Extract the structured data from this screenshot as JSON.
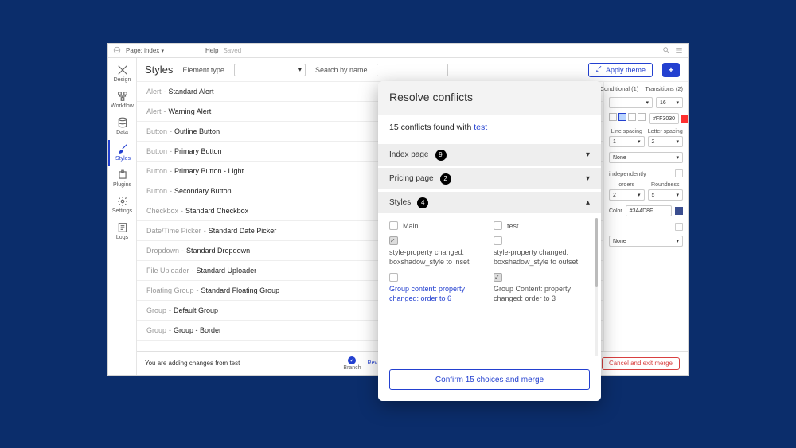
{
  "topbar": {
    "page_label_prefix": "Page:",
    "page_name": "index",
    "help": "Help",
    "saved": "Saved"
  },
  "rail": {
    "items": [
      {
        "id": "design",
        "label": "Design"
      },
      {
        "id": "workflow",
        "label": "Workflow"
      },
      {
        "id": "data",
        "label": "Data"
      },
      {
        "id": "styles",
        "label": "Styles"
      },
      {
        "id": "plugins",
        "label": "Plugins"
      },
      {
        "id": "settings",
        "label": "Settings"
      },
      {
        "id": "logs",
        "label": "Logs"
      }
    ],
    "active": "styles"
  },
  "toolbar": {
    "title": "Styles",
    "element_type_label": "Element type",
    "search_label": "Search by name",
    "apply_label": "Apply theme",
    "plus_label": "+"
  },
  "styles": [
    {
      "cat": "Alert",
      "name": "Standard Alert"
    },
    {
      "cat": "Alert",
      "name": "Warning Alert"
    },
    {
      "cat": "Button",
      "name": "Outline Button"
    },
    {
      "cat": "Button",
      "name": "Primary Button"
    },
    {
      "cat": "Button",
      "name": "Primary Button - Light"
    },
    {
      "cat": "Button",
      "name": "Secondary Button"
    },
    {
      "cat": "Checkbox",
      "name": "Standard Checkbox"
    },
    {
      "cat": "Date/Time Picker",
      "name": "Standard Date Picker"
    },
    {
      "cat": "Dropdown",
      "name": "Standard Dropdown"
    },
    {
      "cat": "File Uploader",
      "name": "Standard Uploader"
    },
    {
      "cat": "Floating Group",
      "name": "Standard Floating Group"
    },
    {
      "cat": "Group",
      "name": "Default Group"
    },
    {
      "cat": "Group",
      "name": "Group - Border"
    }
  ],
  "props": {
    "tabs": {
      "conditional": "Conditional (1)",
      "transitions": "Transitions (2)"
    },
    "font_size": "16",
    "line_spacing_label": "Line spacing",
    "letter_spacing_label": "Letter spacing",
    "line_spacing": "1",
    "letter_spacing": "2",
    "color1": "#FF3030",
    "shadow_label": "None",
    "independent_label": "independently",
    "borders_label": "orders",
    "roundness_label": "Roundness",
    "borders_value": "2",
    "roundness_value": "5",
    "color2_label": "Color",
    "color2": "#3A4D8F",
    "background_label": "None"
  },
  "bottombar": {
    "msg": "You are adding changes from test",
    "branch": "Branch",
    "rev": "Rev",
    "cancel": "Cancel and exit merge"
  },
  "modal": {
    "title": "Resolve conflicts",
    "sub_prefix": "15 conflicts found with ",
    "sub_link": "test",
    "sections": [
      {
        "label": "Index page",
        "count": "9",
        "open": false
      },
      {
        "label": "Pricing page",
        "count": "2",
        "open": false
      },
      {
        "label": "Styles",
        "count": "4",
        "open": true
      }
    ],
    "cols": {
      "left": "Main",
      "right": "test"
    },
    "rows": [
      {
        "left_checked": true,
        "right_checked": false,
        "left_text": "style-property changed: boxshadow_style to inset",
        "right_text": "style-property changed: boxshadow_style to outset",
        "left_selected": false
      },
      {
        "left_checked": false,
        "right_checked": true,
        "left_text": "Group content: property changed: order to 6",
        "right_text": "Group Content: property changed: order to 3",
        "left_selected": true
      }
    ],
    "confirm": "Confirm 15 choices and merge"
  }
}
